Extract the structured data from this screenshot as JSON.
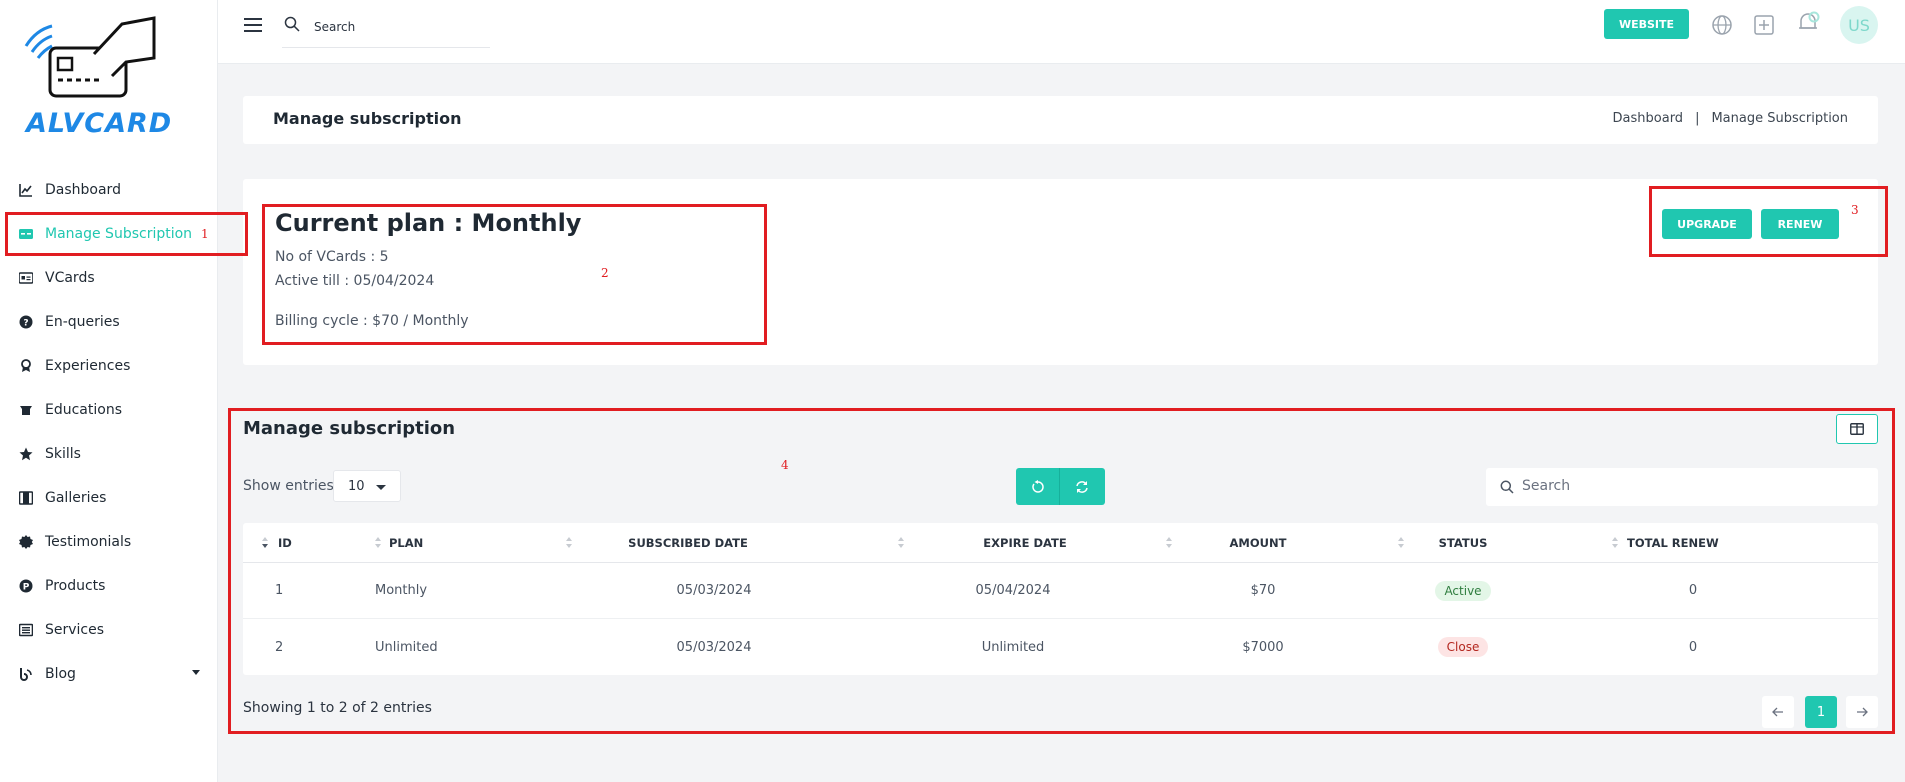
{
  "brand": {
    "name": "ALVCARD",
    "color": "#20c7b0",
    "logo_color": "#1e88e5"
  },
  "sidebar": {
    "items": [
      {
        "label": "Dashboard",
        "icon": "chart-line-icon"
      },
      {
        "label": "Manage Subscription",
        "icon": "card-icon",
        "active": true
      },
      {
        "label": "VCards",
        "icon": "id-card-icon"
      },
      {
        "label": "En-queries",
        "icon": "question-circle-icon"
      },
      {
        "label": "Experiences",
        "icon": "award-icon"
      },
      {
        "label": "Educations",
        "icon": "graduation-cap-icon"
      },
      {
        "label": "Skills",
        "icon": "star-icon"
      },
      {
        "label": "Galleries",
        "icon": "film-icon"
      },
      {
        "label": "Testimonials",
        "icon": "badge-icon"
      },
      {
        "label": "Products",
        "icon": "product-icon"
      },
      {
        "label": "Services",
        "icon": "list-icon"
      },
      {
        "label": "Blog",
        "icon": "blog-icon"
      }
    ]
  },
  "topbar": {
    "search_label": "Search",
    "website_button": "WEBSITE",
    "avatar_initials": "US"
  },
  "header": {
    "title": "Manage subscription",
    "breadcrumb": [
      "Dashboard",
      "Manage Subscription"
    ],
    "separator": "|"
  },
  "plan": {
    "title": "Current plan : Monthly",
    "vcards": "No of VCards : 5",
    "active_till": "Active till : 05/04/2024",
    "billing": "Billing cycle : $70 / Monthly",
    "upgrade_button": "UPGRADE",
    "renew_button": "RENEW"
  },
  "table_section": {
    "title": "Manage subscription",
    "show_entries_label": "Show entries",
    "entries_value": "10",
    "search_placeholder": "Search",
    "columns": [
      "ID",
      "PLAN",
      "SUBSCRIBED DATE",
      "EXPIRE DATE",
      "AMOUNT",
      "STATUS",
      "TOTAL RENEW"
    ],
    "rows": [
      {
        "id": "1",
        "plan": "Monthly",
        "subscribed": "05/03/2024",
        "expire": "05/04/2024",
        "amount": "$70",
        "status": "Active",
        "renew": "0"
      },
      {
        "id": "2",
        "plan": "Unlimited",
        "subscribed": "05/03/2024",
        "expire": "Unlimited",
        "amount": "$7000",
        "status": "Close",
        "renew": "0"
      }
    ],
    "showing_text": "Showing 1 to 2 of 2 entries",
    "current_page": "1"
  },
  "annotations": [
    "1",
    "2",
    "3",
    "4"
  ]
}
